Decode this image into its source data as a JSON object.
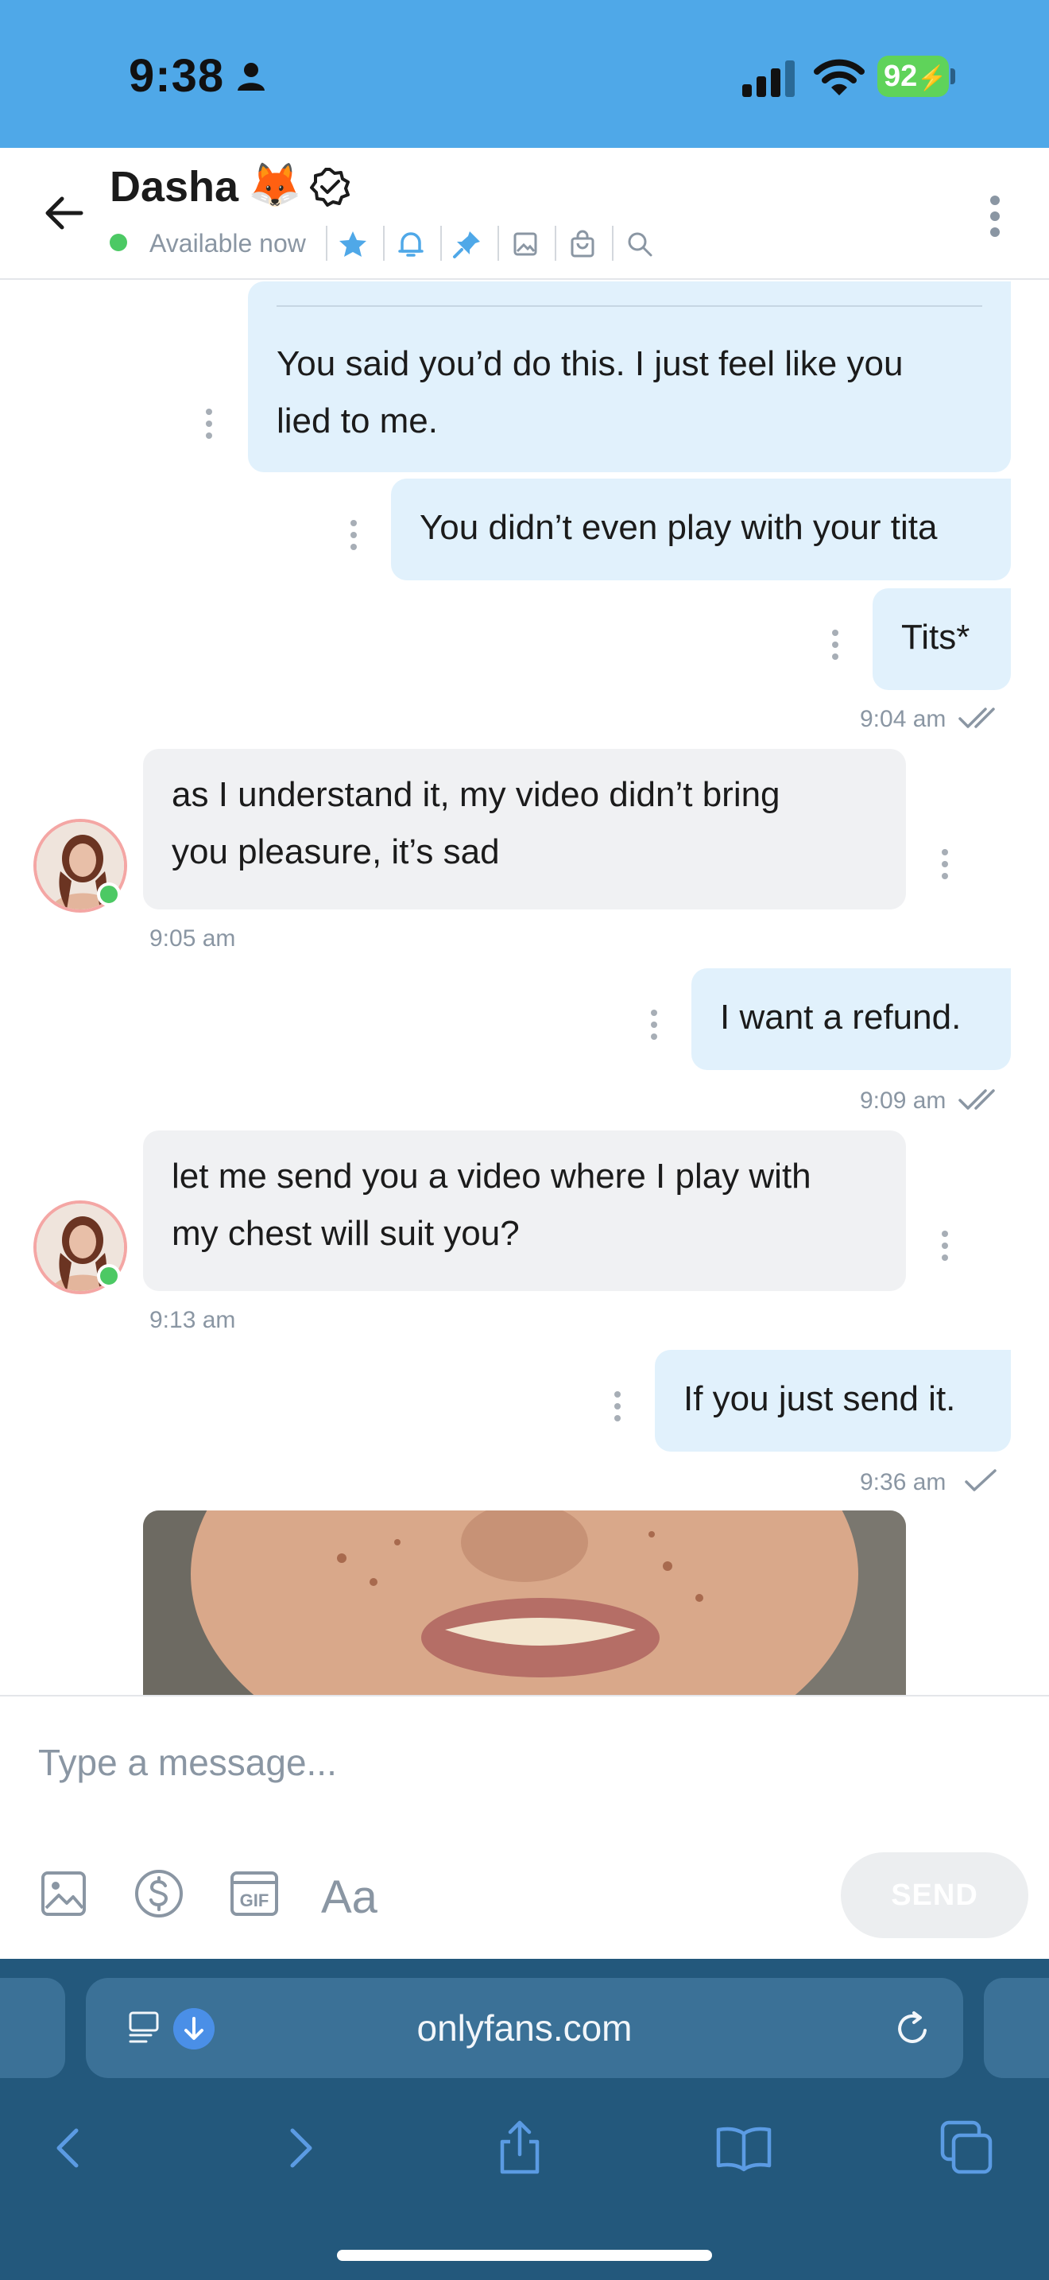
{
  "status_bar": {
    "time": "9:38",
    "battery": "92"
  },
  "header": {
    "name": "Dasha",
    "name_emoji": "🦊",
    "presence": "Available now",
    "icons": [
      "star-icon",
      "bell-icon",
      "pin-icon",
      "image-icon",
      "bag-icon",
      "search-icon"
    ]
  },
  "messages": [
    {
      "dir": "out",
      "text_lines": [
        "You said you’d do this. I just feel like you",
        "lied to me."
      ]
    },
    {
      "dir": "out",
      "text": "You didn’t even play with your tita"
    },
    {
      "dir": "out",
      "text": "Tits*",
      "time": "9:04 am",
      "status": "read"
    },
    {
      "dir": "in",
      "text_lines": [
        "as I understand it, my video didn’t bring",
        "you pleasure, it’s sad"
      ],
      "time": "9:05 am"
    },
    {
      "dir": "out",
      "text": "I want a refund.",
      "time": "9:09 am",
      "status": "read"
    },
    {
      "dir": "in",
      "text_lines": [
        "let me send you a video where I play with",
        "my chest will suit you?"
      ],
      "time": "9:13 am"
    },
    {
      "dir": "out",
      "text": "If you just send it.",
      "time": "9:36 am",
      "status": "sent"
    }
  ],
  "composer": {
    "placeholder": "Type a message...",
    "send_label": "SEND",
    "tools": [
      "image-icon",
      "dollar-icon",
      "gif-icon",
      "font-icon"
    ]
  },
  "browser": {
    "url": "onlyfans.com"
  },
  "colors": {
    "accent": "#4fa8e8",
    "out_bubble": "#e1f1fc",
    "in_bubble": "#f0f1f3",
    "online": "#4cc964",
    "browser": "#23587c"
  }
}
